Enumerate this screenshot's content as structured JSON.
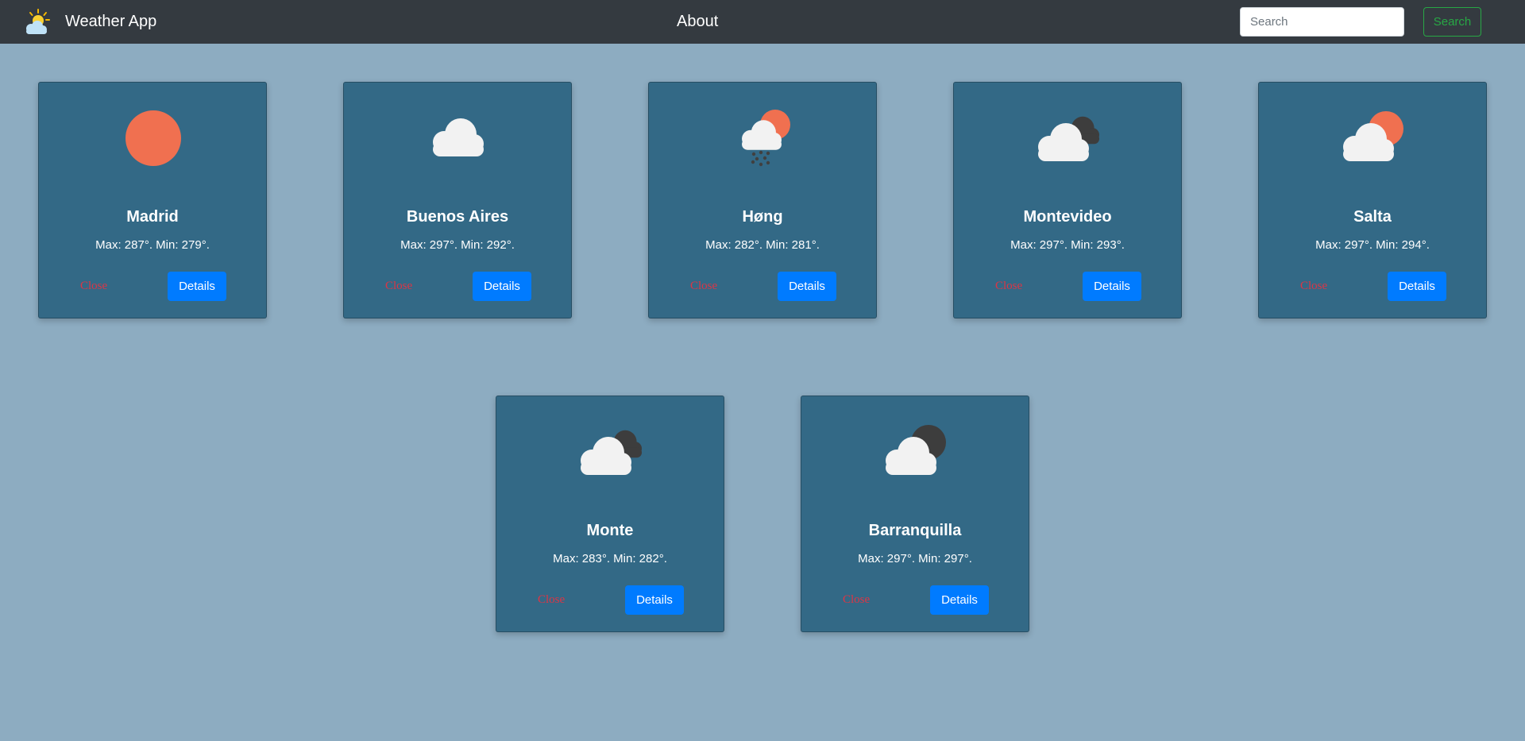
{
  "navbar": {
    "brand_text": "Weather App",
    "brand_icon": "weather-logo-icon",
    "about_label": "About",
    "search_placeholder": "Search",
    "search_value": "",
    "search_button_label": "Search"
  },
  "colors": {
    "page_background": "#8dacc1",
    "navbar_background": "#343a40",
    "card_background": "#336986",
    "details_button": "#007bff",
    "close_text": "#dc3545",
    "search_button": "#28a745",
    "sun": "#f07050",
    "cloud": "#f2f2f2",
    "dark_cloud": "#3d3d3d"
  },
  "cards": [
    {
      "city": "Madrid",
      "temps": "Max: 287°. Min: 279°.",
      "icon": "clear-sun-icon",
      "close_label": "Close",
      "details_label": "Details"
    },
    {
      "city": "Buenos Aires",
      "temps": "Max: 297°. Min: 292°.",
      "icon": "cloud-icon",
      "close_label": "Close",
      "details_label": "Details"
    },
    {
      "city": "Høng",
      "temps": "Max: 282°. Min: 281°.",
      "icon": "rain-sun-cloud-icon",
      "close_label": "Close",
      "details_label": "Details"
    },
    {
      "city": "Montevideo",
      "temps": "Max: 297°. Min: 293°.",
      "icon": "broken-clouds-icon",
      "close_label": "Close",
      "details_label": "Details"
    },
    {
      "city": "Salta",
      "temps": "Max: 297°. Min: 294°.",
      "icon": "sun-cloud-icon",
      "close_label": "Close",
      "details_label": "Details"
    },
    {
      "city": "Monte",
      "temps": "Max: 283°. Min: 282°.",
      "icon": "broken-clouds-icon",
      "close_label": "Close",
      "details_label": "Details"
    },
    {
      "city": "Barranquilla",
      "temps": "Max: 297°. Min: 297°.",
      "icon": "moon-cloud-icon",
      "close_label": "Close",
      "details_label": "Details"
    }
  ]
}
